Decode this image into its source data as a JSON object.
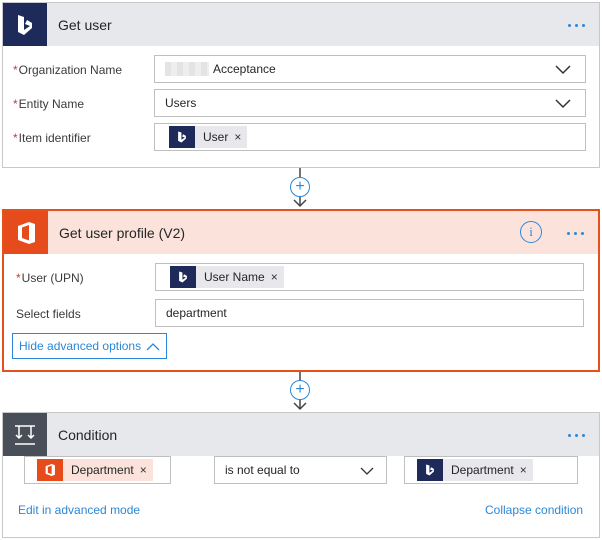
{
  "get_user": {
    "title": "Get user",
    "fields": [
      {
        "label": "Organization Name",
        "required": true,
        "value": "Acceptance"
      },
      {
        "label": "Entity Name",
        "required": true,
        "value": "Users"
      },
      {
        "label": "Item identifier",
        "required": true,
        "token": "User"
      }
    ]
  },
  "get_user_profile": {
    "title": "Get user profile (V2)",
    "fields": [
      {
        "label": "User (UPN)",
        "required": true,
        "token": "User Name"
      },
      {
        "label": "Select fields",
        "required": false,
        "value": "department"
      }
    ],
    "advanced_label": "Hide advanced options"
  },
  "condition": {
    "title": "Condition",
    "left_token": "Department",
    "operator": "is not equal to",
    "right_token": "Department",
    "edit_advanced": "Edit in advanced mode",
    "collapse": "Collapse condition"
  },
  "required_marker": "*",
  "token_remove": "×",
  "add_step_symbol": "+",
  "info_symbol": "i",
  "icons": {
    "dynamics": "dynamics-logo-icon",
    "office": "office-logo-icon",
    "condition": "condition-icon",
    "more": "more-dots-icon"
  },
  "colors": {
    "accent": "#2b88d8",
    "selected_border": "#e5501b",
    "selected_header": "#fbe3dc",
    "header_bg": "#e6e8ec",
    "dynamics_bg": "#1d2a5a",
    "office_orange": "#e54b1b",
    "condition_bg": "#484f58",
    "required": "#d13438"
  }
}
